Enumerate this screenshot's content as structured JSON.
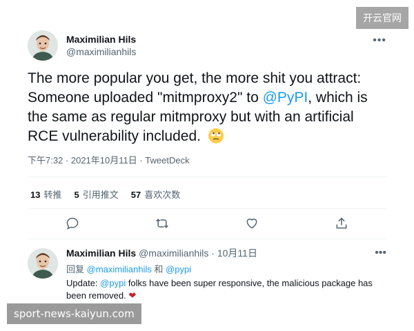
{
  "tweet": {
    "author_name": "Maximilian Hils",
    "author_handle": "@maximilianhils",
    "more": "•••",
    "text_part1": "The more popular you get, the more shit you attract: Someone uploaded \"mitmproxy2\" to ",
    "text_link": "@PyPI",
    "text_part2": ", which is the same as regular mitmproxy but with an artificial RCE vulnerability included.",
    "emoji_icon": "rolling-eyes-emoji",
    "time": "下午7:32 · 2021年10月11日",
    "source": "TweetDeck"
  },
  "stats": {
    "retweets_count": "13",
    "retweets_label": "转推",
    "quotes_count": "5",
    "quotes_label": "引用推文",
    "likes_count": "57",
    "likes_label": "喜欢次数"
  },
  "reply": {
    "author_name": "Maximilian Hils",
    "author_handle": "@maximilianhils",
    "date": "· 10月11日",
    "more": "•••",
    "reply_prefix": "回复",
    "reply_to_1": "@maximilianhils",
    "reply_and": "和",
    "reply_to_2": "@pypi",
    "text_part1": "Update: ",
    "text_link": "@pypi",
    "text_part2": " folks have been super responsive, the malicious package has been removed."
  },
  "watermarks": {
    "top": "开云官网",
    "bottom": "sport-news-kaiyun.com"
  },
  "colors": {
    "link": "#1d9bf0",
    "muted": "#536471",
    "heart": "#c4232a"
  }
}
